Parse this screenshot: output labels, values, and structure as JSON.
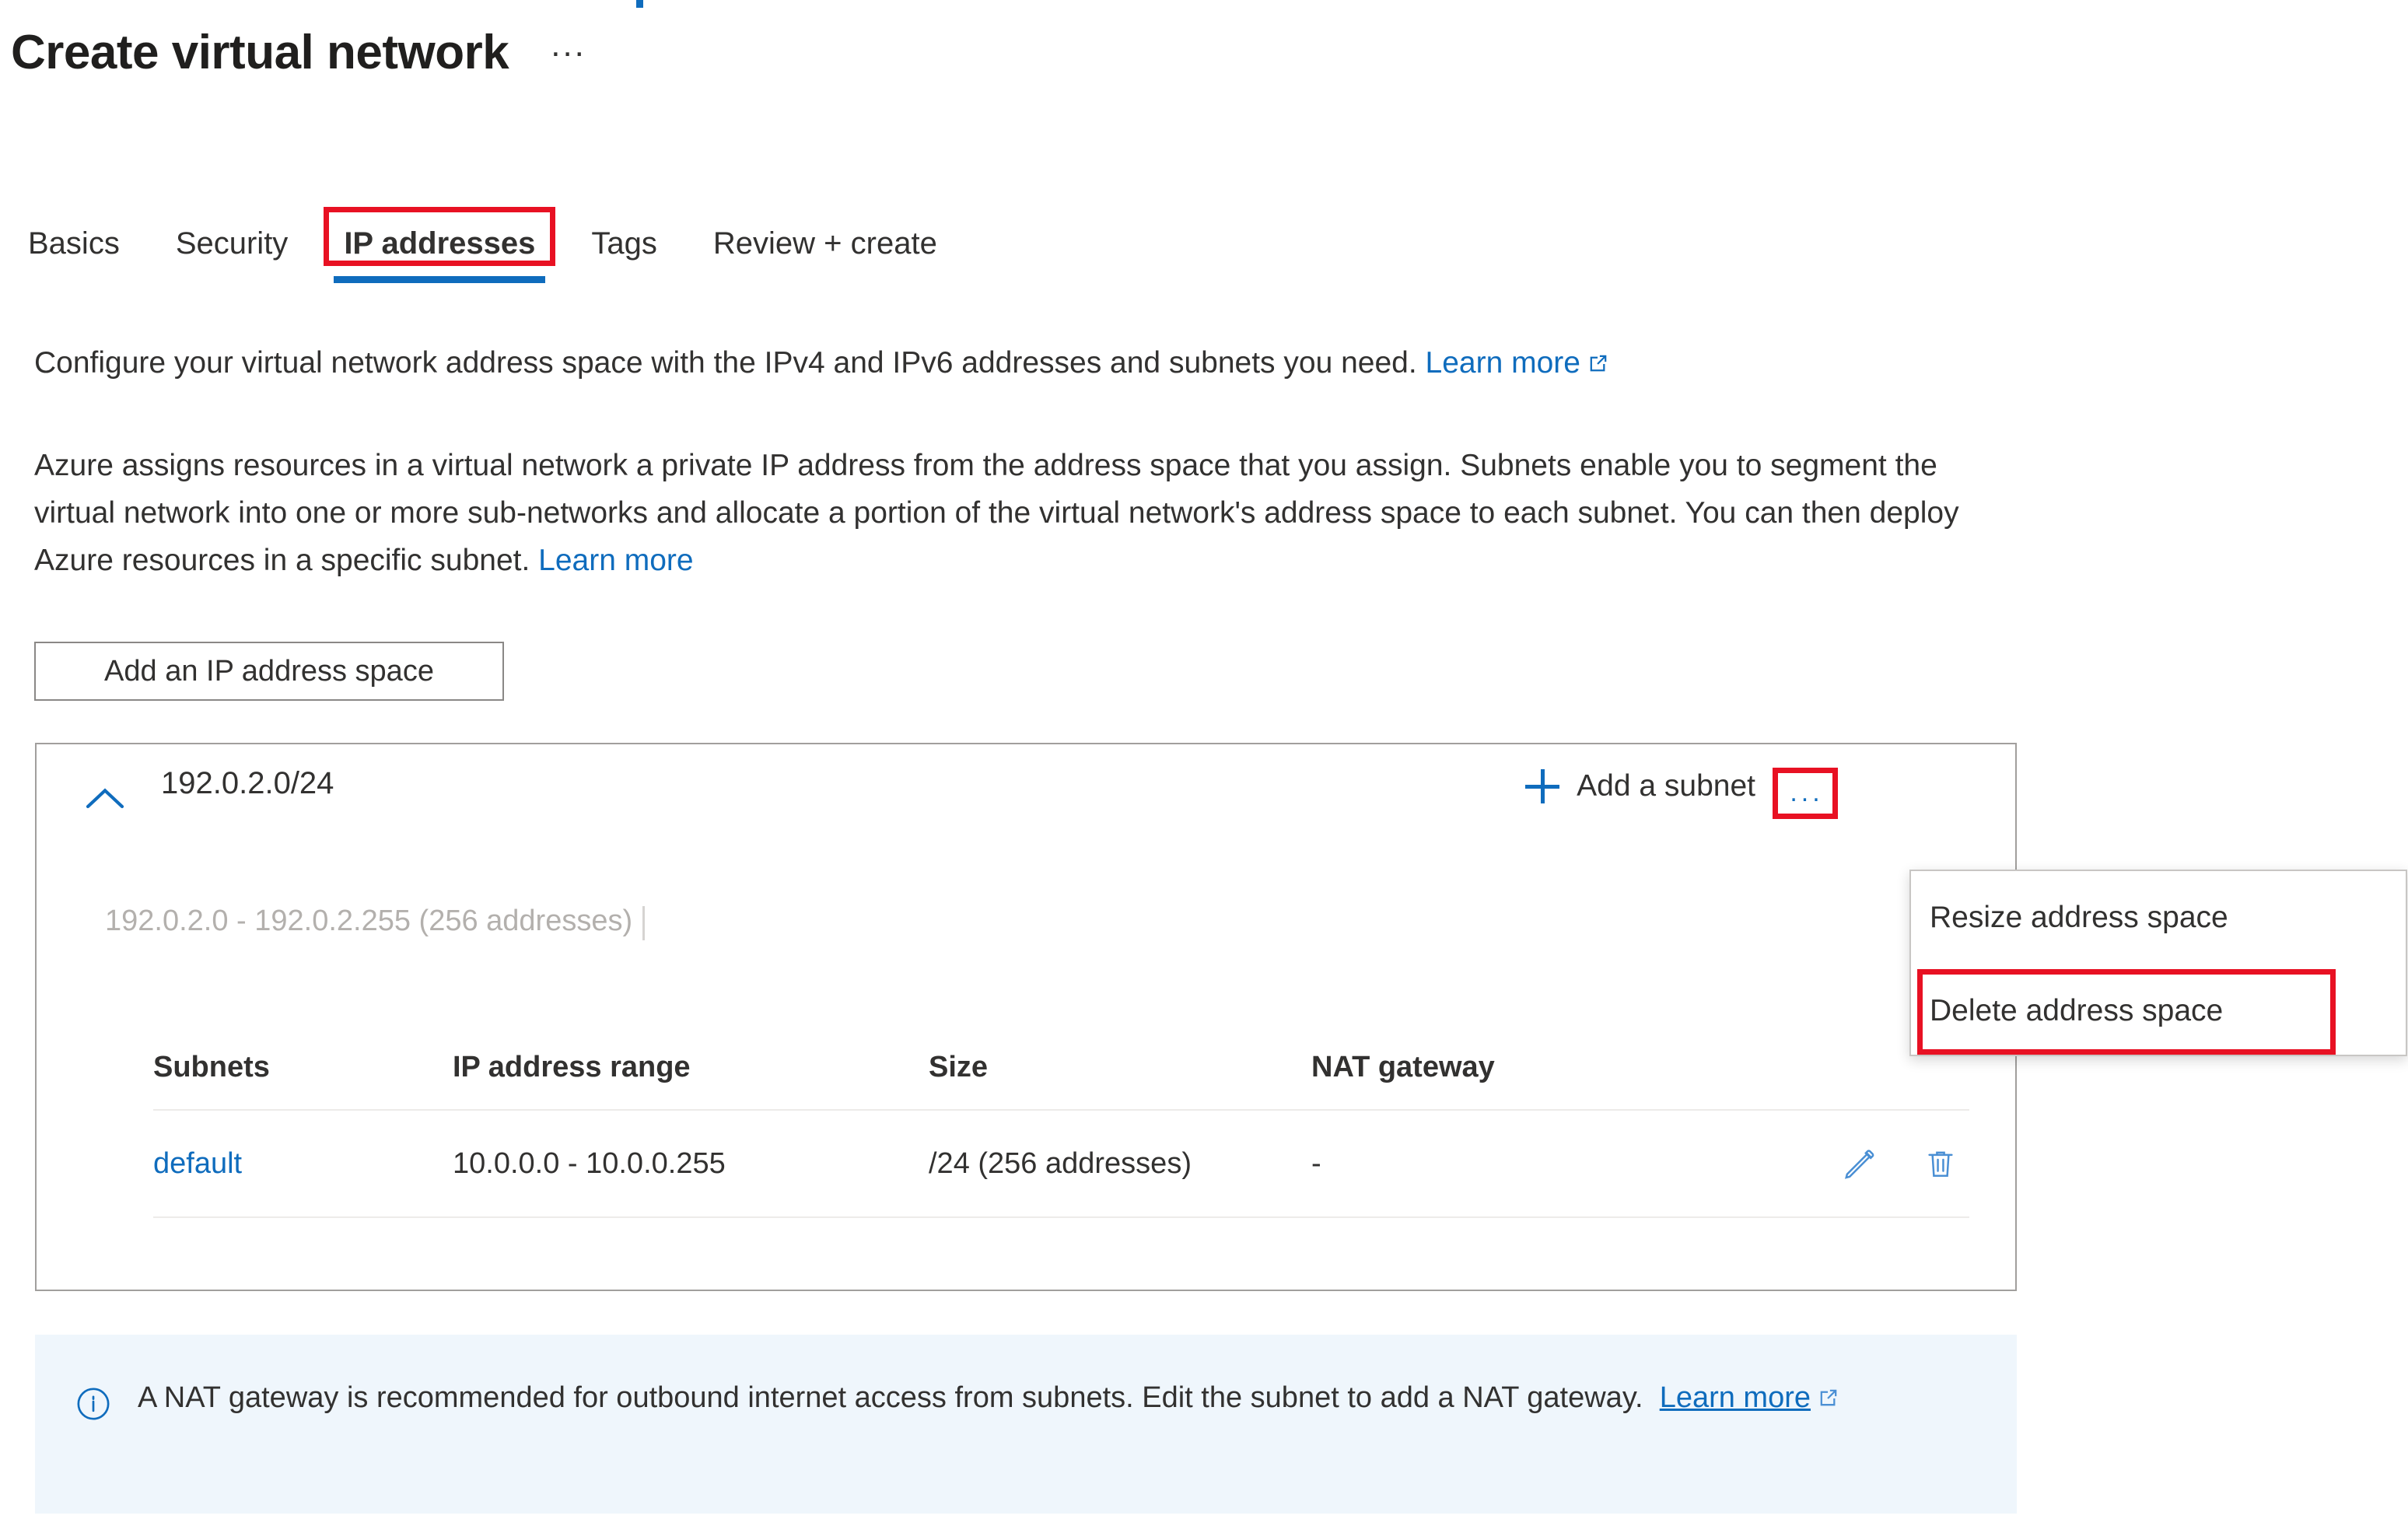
{
  "page": {
    "title": "Create virtual network",
    "title_more_label": "...",
    "top_fragment_color": "#0f6cbd"
  },
  "tabs": [
    {
      "label": "Basics",
      "selected": false
    },
    {
      "label": "Security",
      "selected": false
    },
    {
      "label": "IP addresses",
      "selected": true,
      "highlighted": true
    },
    {
      "label": "Tags",
      "selected": false
    },
    {
      "label": "Review + create",
      "selected": false
    }
  ],
  "intro": {
    "paragraph1_text": "Configure your virtual network address space with the IPv4 and IPv6 addresses and subnets you need.",
    "paragraph1_link": "Learn more",
    "paragraph2_text": "Azure assigns resources in a virtual network a private IP address from the address space that you assign. Subnets enable you to segment the virtual network into one or more sub-networks and allocate a portion of the virtual network's address space to each subnet. You can then deploy Azure resources in a specific subnet.",
    "paragraph2_link": "Learn more"
  },
  "actions": {
    "add_address_space": "Add an IP address space"
  },
  "address_space": {
    "cidr": "192.0.2.0/24",
    "range_summary": "192.0.2.0 - 192.0.2.255 (256 addresses)",
    "add_subnet_label": "Add a subnet",
    "more_label": "...",
    "expanded": true
  },
  "context_menu": {
    "items": [
      {
        "label": "Resize address space",
        "highlighted": false
      },
      {
        "label": "Delete address space",
        "highlighted": true
      }
    ]
  },
  "subnets_table": {
    "columns": [
      "Subnets",
      "IP address range",
      "Size",
      "NAT gateway"
    ],
    "rows": [
      {
        "subnet": "default",
        "ip_range": "10.0.0.0 - 10.0.0.255",
        "size": "/24 (256 addresses)",
        "nat_gateway": "-"
      }
    ]
  },
  "banner": {
    "text": "A NAT gateway is recommended for outbound internet access from subnets. Edit the subnet to add a NAT gateway.",
    "link": "Learn more"
  },
  "colors": {
    "accent_blue": "#0f6cbd",
    "highlight_red": "#e81123",
    "banner_bg": "#eff6fc",
    "text": "#323130",
    "muted": "#b3b0ad"
  }
}
